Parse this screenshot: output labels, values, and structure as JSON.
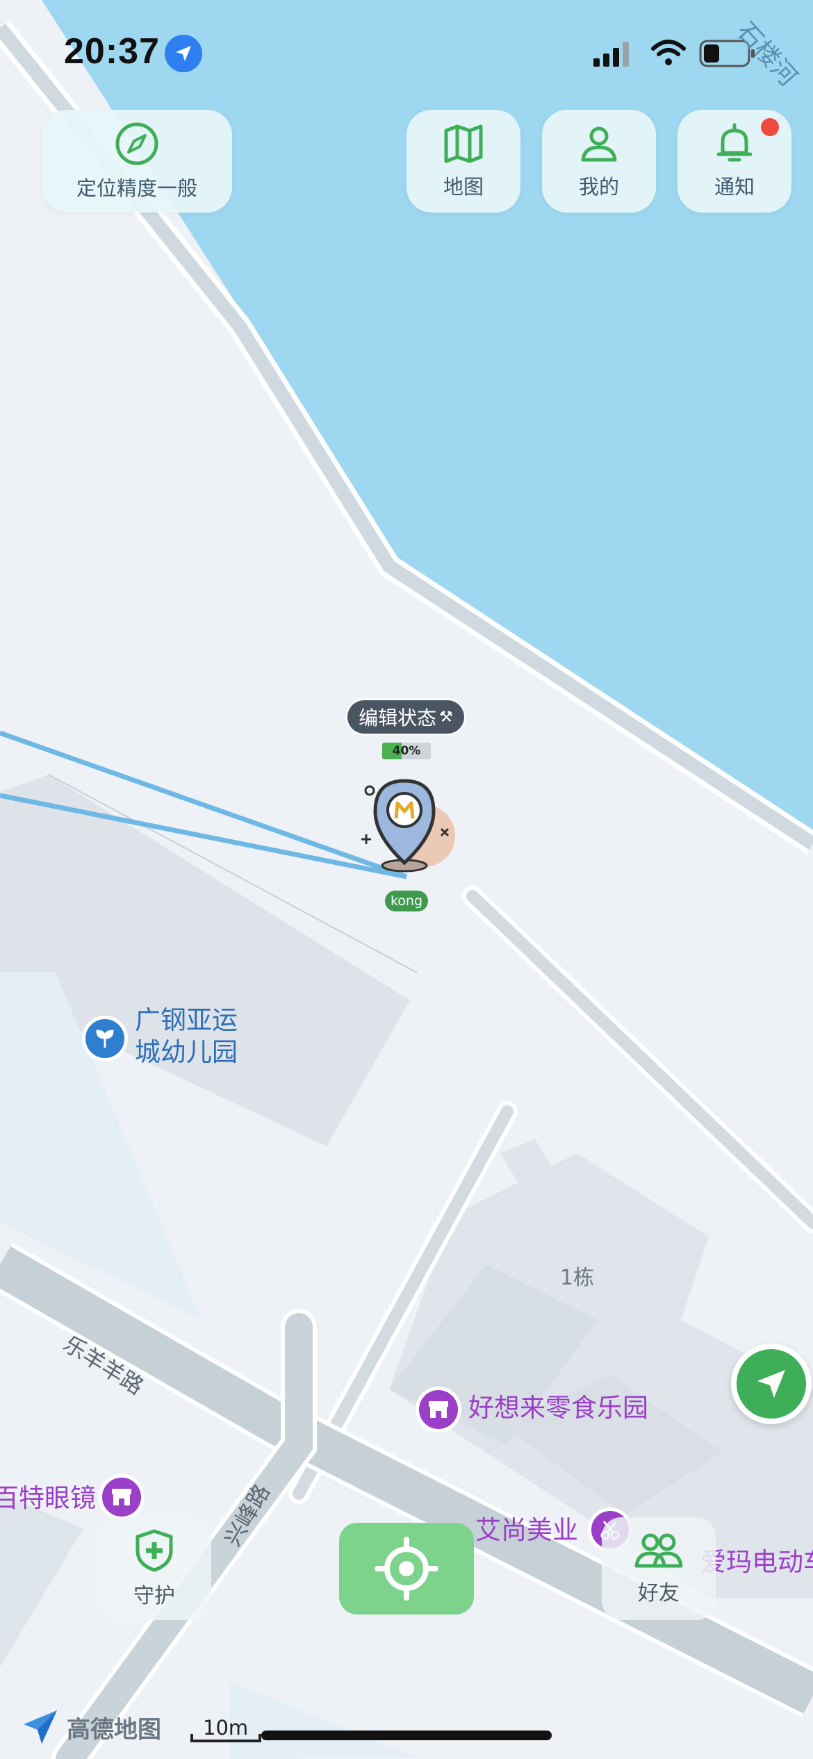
{
  "status_bar": {
    "time": "20:37"
  },
  "corner_label": "石楼河",
  "top_buttons": {
    "accuracy": "定位精度一般",
    "map": "地图",
    "mine": "我的",
    "notify": "通知"
  },
  "marker": {
    "status": "编辑状态",
    "battery_percent": 40,
    "battery_label": "40%",
    "user_name": "kong"
  },
  "pois": {
    "kindergarten_line1": "广钢亚运",
    "kindergarten_line2": "城幼儿园",
    "building": "1栋",
    "snack_shop": "好想来零食乐园",
    "glasses": "百特眼镜",
    "beauty": "艾尚美业",
    "ebike": "爱玛电动车"
  },
  "roads": {
    "leyang": "乐羊羊路",
    "xingfeng": "兴峰路"
  },
  "bottom_buttons": {
    "guard": "守护",
    "friends": "好友"
  },
  "map_brand": "高德地图",
  "scale": "10m",
  "colors": {
    "water": "#9ed8f0",
    "land": "#eef2f6",
    "road": "#c9d3da",
    "accent_green": "#3fae58",
    "poi_purple": "#9b3fc8",
    "poi_blue": "#2f7fd0"
  },
  "icons": [
    "location-arrow-icon",
    "compass-icon",
    "map-icon",
    "user-icon",
    "bell-icon",
    "shield-icon",
    "crosshair-icon",
    "friends-icon",
    "navigate-icon",
    "kindergarten-icon",
    "shop-icon",
    "scissors-icon"
  ]
}
